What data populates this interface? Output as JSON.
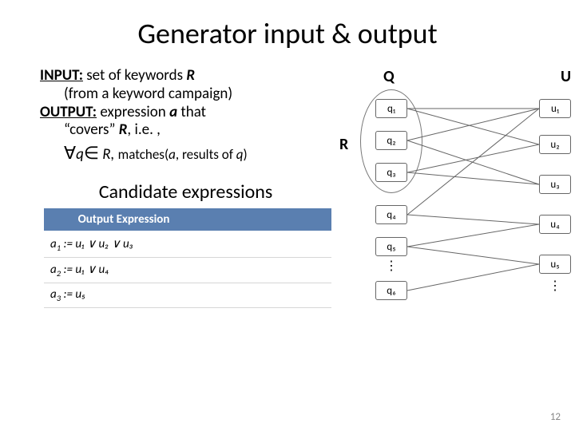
{
  "title": "Generator input & output",
  "text": {
    "input_label": "INPUT:",
    "input_rest": " set of keywords ",
    "input_R": "R",
    "input_line2": "(from a keyword campaign)",
    "output_label": "OUTPUT:",
    "output_rest": " expression ",
    "output_a": "a",
    "output_rest2": " that",
    "output_line2a": "“covers” ",
    "output_line2b": "R",
    "output_line2c": ", i.e. ,",
    "quant_forall": "∀",
    "quant_q": "q",
    "quant_in": "∈",
    "quant_R": " R, ",
    "quant_matches": "matches(",
    "quant_a": "a",
    "quant_mid": ", results of ",
    "quant_q2": "q",
    "quant_end": ")"
  },
  "candidate_heading": "Candidate expressions",
  "table": {
    "header": "Output Expression",
    "rows": [
      {
        "name": "a",
        "sub": "1",
        "expr": " := u₁ ∨ u₂ ∨ u₃"
      },
      {
        "name": "a",
        "sub": "2",
        "expr": " := u₁ ∨ u₄"
      },
      {
        "name": "a",
        "sub": "3",
        "expr": " := u₅"
      }
    ]
  },
  "diagram": {
    "Q": "Q",
    "R": "R",
    "U": "U",
    "q": [
      "q₁",
      "q₂",
      "q₃",
      "q₄",
      "q₅",
      "q₆"
    ],
    "u": [
      "u₁",
      "u₂",
      "u₃",
      "u₄",
      "u₅"
    ]
  },
  "page": "12"
}
